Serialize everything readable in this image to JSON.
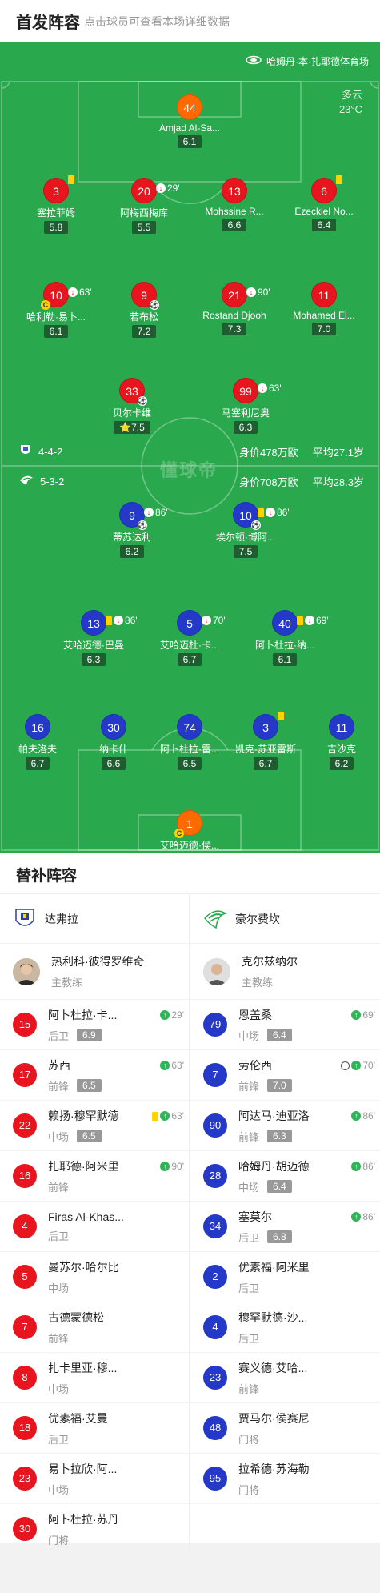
{
  "header": {
    "title": "首发阵容",
    "subtitle": "点击球员可查看本场详细数据"
  },
  "pitch": {
    "stadium": "哈姆丹·本·扎耶德体育场",
    "weather": "多云",
    "temperature": "23°C",
    "watermark": "懂球帝",
    "home_team": {
      "formation": "4-4-2",
      "value": "身价478万欧",
      "avg_age": "平均27.1岁"
    },
    "away_team": {
      "formation": "5-3-2",
      "value": "身价708万欧",
      "avg_age": "平均28.3岁"
    },
    "home_players": [
      {
        "num": "44",
        "name": "Amjad Al-Sa...",
        "rating": "6.1",
        "color": "orange",
        "events": ""
      },
      {
        "num": "3",
        "name": "塞拉菲姆",
        "rating": "5.8",
        "color": "red",
        "events": "",
        "card": true
      },
      {
        "num": "20",
        "name": "阿梅西梅库",
        "rating": "5.5",
        "color": "red",
        "events": "29'",
        "subout": true
      },
      {
        "num": "13",
        "name": "Mohssine R...",
        "rating": "6.6",
        "color": "red",
        "events": ""
      },
      {
        "num": "6",
        "name": "Ezeckiel No...",
        "rating": "6.4",
        "color": "red",
        "events": "",
        "card": true
      },
      {
        "num": "10",
        "name": "哈利勒·易卜...",
        "rating": "6.1",
        "color": "red",
        "events": "63'",
        "subout": true,
        "captain": true
      },
      {
        "num": "9",
        "name": "若布松",
        "rating": "7.2",
        "color": "red",
        "events": "",
        "ball": true
      },
      {
        "num": "21",
        "name": "Rostand Djooh",
        "rating": "7.3",
        "color": "red",
        "events": "90'",
        "subout": true
      },
      {
        "num": "11",
        "name": "Mohamed El...",
        "rating": "7.0",
        "color": "red",
        "events": ""
      },
      {
        "num": "33",
        "name": "贝尔卡维",
        "rating": "7.5",
        "color": "red",
        "events": "",
        "ball": true,
        "star": true
      },
      {
        "num": "99",
        "name": "马塞利尼奥",
        "rating": "6.3",
        "color": "red",
        "events": "63'",
        "subout": true
      }
    ],
    "away_players": [
      {
        "num": "9",
        "name": "蒂苏达利",
        "rating": "6.2",
        "color": "blue",
        "events": "86'",
        "subout": true,
        "ball": true
      },
      {
        "num": "10",
        "name": "埃尔顿·博阿...",
        "rating": "7.5",
        "color": "blue",
        "events": "86'",
        "subout": true,
        "card": true,
        "ball": true
      },
      {
        "num": "13",
        "name": "艾哈迈德·巴曼",
        "rating": "6.3",
        "color": "blue",
        "events": "86'",
        "subout": true,
        "card": true
      },
      {
        "num": "5",
        "name": "艾哈迈杜·卡...",
        "rating": "6.7",
        "color": "blue",
        "events": "70'",
        "subout": true
      },
      {
        "num": "40",
        "name": "阿卜杜拉·纳...",
        "rating": "6.1",
        "color": "blue",
        "events": "69'",
        "subout": true,
        "card": true
      },
      {
        "num": "16",
        "name": "帕夫洛夫",
        "rating": "6.7",
        "color": "blue",
        "events": ""
      },
      {
        "num": "30",
        "name": "纳卡什",
        "rating": "6.6",
        "color": "blue",
        "events": ""
      },
      {
        "num": "74",
        "name": "阿卜杜拉·雷...",
        "rating": "6.5",
        "color": "blue",
        "events": ""
      },
      {
        "num": "3",
        "name": "凯克·苏亚雷斯",
        "rating": "6.7",
        "color": "blue",
        "events": "",
        "card": true
      },
      {
        "num": "11",
        "name": "吉沙克",
        "rating": "6.2",
        "color": "blue",
        "events": ""
      },
      {
        "num": "1",
        "name": "艾哈迈德·侯...",
        "rating": "6.8",
        "color": "orange",
        "events": "",
        "captain": true
      }
    ]
  },
  "subs_header": {
    "title": "替补阵容"
  },
  "subs": {
    "home": {
      "team_name": "达弗拉",
      "coach": {
        "name": "热利科·彼得罗维奇",
        "role": "主教练"
      },
      "players": [
        {
          "num": "15",
          "name": "阿卜杜拉·卡...",
          "pos": "后卫",
          "rating": "6.9",
          "event": "29'"
        },
        {
          "num": "17",
          "name": "苏西",
          "pos": "前锋",
          "rating": "6.5",
          "event": "63'"
        },
        {
          "num": "22",
          "name": "赖扬·穆罕默德",
          "pos": "中场",
          "rating": "6.5",
          "event": "63'",
          "card": true
        },
        {
          "num": "16",
          "name": "扎耶德·阿米里",
          "pos": "前锋",
          "rating": "",
          "event": "90'"
        },
        {
          "num": "4",
          "name": "Firas Al-Khas...",
          "pos": "后卫",
          "rating": "",
          "event": ""
        },
        {
          "num": "5",
          "name": "曼苏尔·哈尔比",
          "pos": "中场",
          "rating": "",
          "event": ""
        },
        {
          "num": "7",
          "name": "古德蒙德松",
          "pos": "前锋",
          "rating": "",
          "event": ""
        },
        {
          "num": "8",
          "name": "扎卡里亚·穆...",
          "pos": "中场",
          "rating": "",
          "event": ""
        },
        {
          "num": "18",
          "name": "优素福·艾曼",
          "pos": "后卫",
          "rating": "",
          "event": ""
        },
        {
          "num": "23",
          "name": "易卜拉欣·阿...",
          "pos": "中场",
          "rating": "",
          "event": ""
        },
        {
          "num": "30",
          "name": "阿卜杜拉·苏丹",
          "pos": "门将",
          "rating": "",
          "event": ""
        }
      ]
    },
    "away": {
      "team_name": "豪尔费坎",
      "coach": {
        "name": "克尔兹纳尔",
        "role": "主教练"
      },
      "players": [
        {
          "num": "79",
          "name": "恩盖桑",
          "pos": "中场",
          "rating": "6.4",
          "event": "69'"
        },
        {
          "num": "7",
          "name": "劳伦西",
          "pos": "前锋",
          "rating": "7.0",
          "event": "70'",
          "ball": true
        },
        {
          "num": "90",
          "name": "阿达马·迪亚洛",
          "pos": "前锋",
          "rating": "6.3",
          "event": "86'"
        },
        {
          "num": "28",
          "name": "哈姆丹·胡迈德",
          "pos": "中场",
          "rating": "6.4",
          "event": "86'"
        },
        {
          "num": "34",
          "name": "塞莫尔",
          "pos": "后卫",
          "rating": "6.8",
          "event": "86'"
        },
        {
          "num": "2",
          "name": "优素福·阿米里",
          "pos": "后卫",
          "rating": "",
          "event": ""
        },
        {
          "num": "4",
          "name": "穆罕默德·沙...",
          "pos": "后卫",
          "rating": "",
          "event": ""
        },
        {
          "num": "23",
          "name": "赛义德·艾哈...",
          "pos": "前锋",
          "rating": "",
          "event": ""
        },
        {
          "num": "48",
          "name": "贾马尔·侯赛尼",
          "pos": "门将",
          "rating": "",
          "event": ""
        },
        {
          "num": "95",
          "name": "拉希德·苏海勒",
          "pos": "门将",
          "rating": "",
          "event": ""
        }
      ]
    }
  },
  "colors": {
    "pitch": "#2aa84d",
    "home": "#e8141e",
    "away": "#2539c9",
    "keeper": "#ff6a00"
  }
}
